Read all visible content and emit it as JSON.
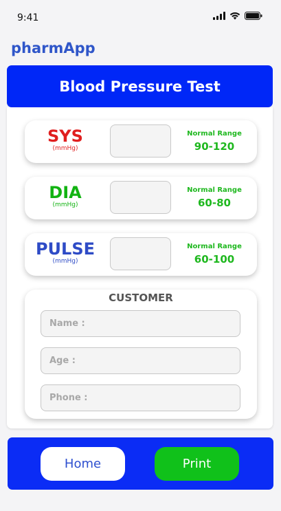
{
  "status_bar": {
    "time": "9:41",
    "icons": [
      "signal-icon",
      "wifi-icon",
      "battery-icon"
    ]
  },
  "app": {
    "title": "pharmApp"
  },
  "header": {
    "title": "Blood Pressure Test"
  },
  "measurements": [
    {
      "name": "SYS",
      "unit": "(mmHg)",
      "color": "#e01f1f",
      "range_title": "Normal Range",
      "range_value": "90-120",
      "value": ""
    },
    {
      "name": "DIA",
      "unit": "(mmHg)",
      "color": "#12b312",
      "range_title": "Normal Range",
      "range_value": "60-80",
      "value": ""
    },
    {
      "name": "PULSE",
      "unit": "(mmHg)",
      "color": "#2e4bc6",
      "range_title": "Normal Range",
      "range_value": "60-100",
      "value": ""
    }
  ],
  "customer": {
    "title": "CUSTOMER",
    "name_placeholder": "Name :",
    "age_placeholder": "Age :",
    "phone_placeholder": "Phone :"
  },
  "actions": {
    "home_label": "Home",
    "print_label": "Print"
  },
  "colors": {
    "brand": "#0027f7",
    "range_green": "#1fb81f",
    "print_green": "#10c11a",
    "app_title_blue": "#2f56c9"
  }
}
